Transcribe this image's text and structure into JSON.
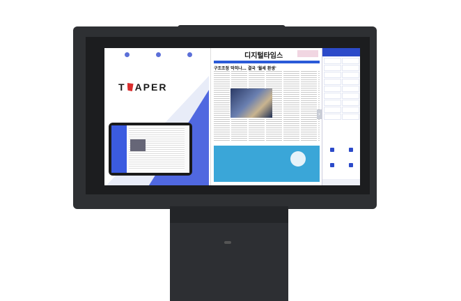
{
  "screen": {
    "left_panel": {
      "top_icons": [
        "",
        "",
        ""
      ],
      "tagline": "",
      "logo_before": "T",
      "logo_after": "APER"
    },
    "newspaper": {
      "masthead_left": "",
      "title": "디지털타임스",
      "ad_badge": "",
      "headline": "구조조정 막히나… 결국 '월세 환생'",
      "sub_headline": "",
      "ad_lines": [
        "",
        "",
        ""
      ]
    },
    "nav": {
      "top_label": "",
      "items": [
        "",
        "",
        "",
        "",
        "",
        "",
        "",
        "",
        "",
        "",
        "",
        "",
        "",
        "",
        "",
        "",
        "",
        ""
      ],
      "bottom_buttons": [
        "",
        "",
        "",
        ""
      ],
      "footer": ""
    },
    "next_arrow": "›"
  },
  "colors": {
    "accent": "#2c4ac9",
    "logo_red": "#d92d2d",
    "ad_blue": "#3aa6d8",
    "kiosk_body": "#2e3033"
  }
}
